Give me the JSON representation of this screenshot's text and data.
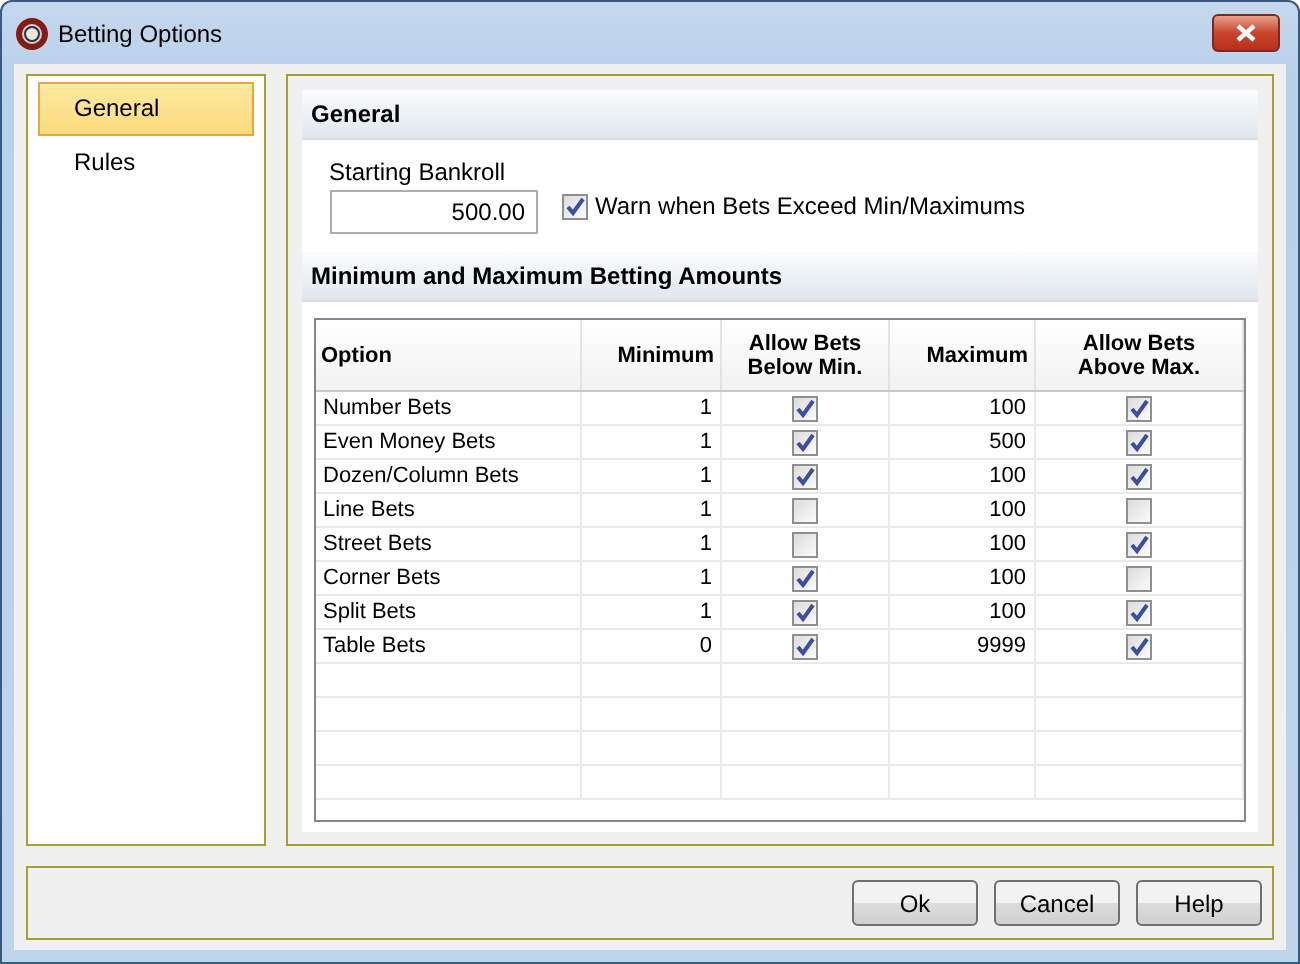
{
  "window": {
    "title": "Betting Options"
  },
  "sidebar": {
    "items": [
      {
        "label": "General",
        "selected": true
      },
      {
        "label": "Rules",
        "selected": false
      }
    ]
  },
  "general": {
    "heading": "General",
    "bankroll_label": "Starting Bankroll",
    "bankroll_value": "500.00",
    "warn": {
      "label": "Warn when Bets Exceed Min/Maximums",
      "checked": true
    }
  },
  "limits": {
    "heading": "Minimum and Maximum Betting Amounts",
    "columns": [
      "Option",
      "Minimum",
      "Allow Bets Below Min.",
      "Maximum",
      "Allow Bets Above Max."
    ],
    "rows": [
      {
        "option": "Number Bets",
        "minimum": "1",
        "allow_below": true,
        "maximum": "100",
        "allow_above": true
      },
      {
        "option": "Even Money Bets",
        "minimum": "1",
        "allow_below": true,
        "maximum": "500",
        "allow_above": true
      },
      {
        "option": "Dozen/Column Bets",
        "minimum": "1",
        "allow_below": true,
        "maximum": "100",
        "allow_above": true
      },
      {
        "option": "Line Bets",
        "minimum": "1",
        "allow_below": false,
        "maximum": "100",
        "allow_above": false
      },
      {
        "option": "Street Bets",
        "minimum": "1",
        "allow_below": false,
        "maximum": "100",
        "allow_above": true
      },
      {
        "option": "Corner Bets",
        "minimum": "1",
        "allow_below": true,
        "maximum": "100",
        "allow_above": false
      },
      {
        "option": "Split Bets",
        "minimum": "1",
        "allow_below": true,
        "maximum": "100",
        "allow_above": true
      },
      {
        "option": "Table Bets",
        "minimum": "0",
        "allow_below": true,
        "maximum": "9999",
        "allow_above": true
      }
    ]
  },
  "buttons": [
    "Ok",
    "Cancel",
    "Help"
  ]
}
